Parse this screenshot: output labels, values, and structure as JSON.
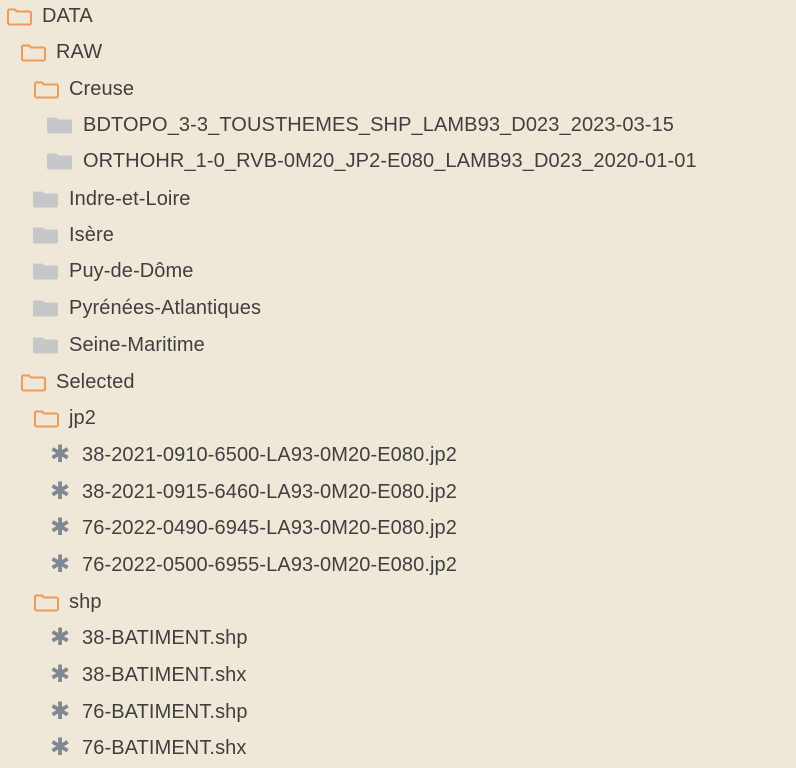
{
  "tree": {
    "items": [
      {
        "label": "DATA",
        "icon": "folder-open-icon"
      },
      {
        "label": "RAW",
        "icon": "folder-open-icon"
      },
      {
        "label": "Creuse",
        "icon": "folder-open-icon"
      },
      {
        "label": "BDTOPO_3-3_TOUSTHEMES_SHP_LAMB93_D023_2023-03-15",
        "icon": "folder-closed-icon"
      },
      {
        "label": "ORTHOHR_1-0_RVB-0M20_JP2-E080_LAMB93_D023_2020-01-01",
        "icon": "folder-closed-icon"
      },
      {
        "label": "Indre-et-Loire",
        "icon": "folder-closed-icon"
      },
      {
        "label": "Isère",
        "icon": "folder-closed-icon"
      },
      {
        "label": "Puy-de-Dôme",
        "icon": "folder-closed-icon"
      },
      {
        "label": "Pyrénées-Atlantiques",
        "icon": "folder-closed-icon"
      },
      {
        "label": "Seine-Maritime",
        "icon": "folder-closed-icon"
      },
      {
        "label": "Selected",
        "icon": "folder-open-icon"
      },
      {
        "label": "jp2",
        "icon": "folder-open-icon"
      },
      {
        "label": "38-2021-0910-6500-LA93-0M20-E080.jp2",
        "icon": "asterisk-icon"
      },
      {
        "label": "38-2021-0915-6460-LA93-0M20-E080.jp2",
        "icon": "asterisk-icon"
      },
      {
        "label": "76-2022-0490-6945-LA93-0M20-E080.jp2",
        "icon": "asterisk-icon"
      },
      {
        "label": "76-2022-0500-6955-LA93-0M20-E080.jp2",
        "icon": "asterisk-icon"
      },
      {
        "label": "shp",
        "icon": "folder-open-icon"
      },
      {
        "label": "38-BATIMENT.shp",
        "icon": "asterisk-icon"
      },
      {
        "label": "38-BATIMENT.shx",
        "icon": "asterisk-icon"
      },
      {
        "label": "76-BATIMENT.shp",
        "icon": "asterisk-icon"
      },
      {
        "label": "76-BATIMENT.shx",
        "icon": "asterisk-icon"
      }
    ]
  },
  "colors": {
    "background": "#efe8d8",
    "open_folder": "#ef9a57",
    "closed_folder": "#c6c7c8",
    "file_icon": "#7f8790",
    "text": "#3f3f3f"
  }
}
